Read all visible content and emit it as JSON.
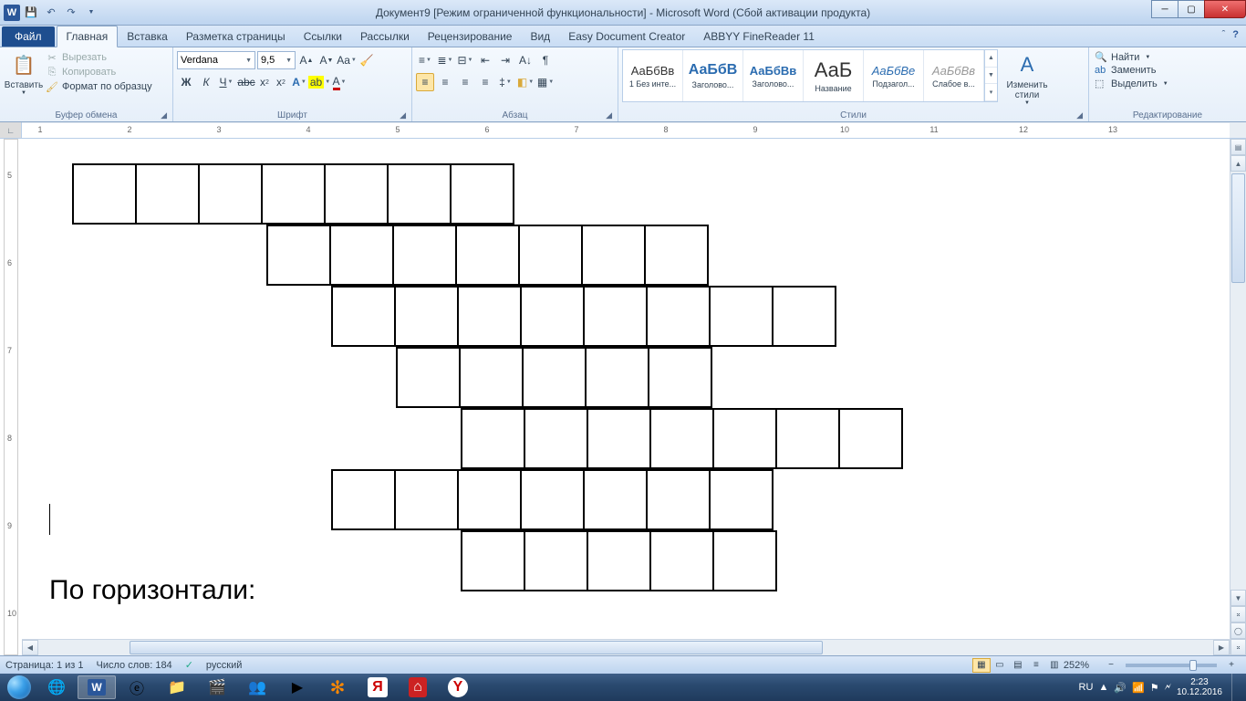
{
  "title": "Документ9 [Режим ограниченной функциональности]  -  Microsoft Word (Сбой активации продукта)",
  "tabs": {
    "file": "Файл",
    "items": [
      "Главная",
      "Вставка",
      "Разметка страницы",
      "Ссылки",
      "Рассылки",
      "Рецензирование",
      "Вид",
      "Easy Document Creator",
      "ABBYY FineReader 11"
    ],
    "active": 0
  },
  "clipboard": {
    "paste": "Вставить",
    "cut": "Вырезать",
    "copy": "Копировать",
    "fmt_painter": "Формат по образцу",
    "label": "Буфер обмена"
  },
  "font": {
    "name": "Verdana",
    "size": "9,5",
    "label": "Шрифт"
  },
  "paragraph": {
    "label": "Абзац"
  },
  "styles": {
    "label": "Стили",
    "items": [
      {
        "preview": "АаБбВв",
        "name": "1 Без инте..."
      },
      {
        "preview": "АаБбВ",
        "name": "Заголово..."
      },
      {
        "preview": "АаБбВв",
        "name": "Заголово..."
      },
      {
        "preview": "АаБ",
        "name": "Название"
      },
      {
        "preview": "АаБбВе",
        "name": "Подзагол..."
      },
      {
        "preview": "АаБбВв",
        "name": "Слабое в..."
      }
    ],
    "change": "Изменить стили"
  },
  "editing": {
    "find": "Найти",
    "replace": "Заменить",
    "select": "Выделить",
    "label": "Редактирование"
  },
  "ruler_numbers": [
    1,
    2,
    3,
    4,
    5,
    6,
    7,
    8,
    9,
    10,
    11,
    12,
    13
  ],
  "ruler_v_numbers": [
    5,
    6,
    7,
    8,
    9,
    10
  ],
  "document": {
    "heading": "По горизонтали:",
    "crossword": [
      [
        1,
        1,
        1,
        1,
        1,
        1,
        1,
        0,
        0,
        0,
        0,
        0,
        0
      ],
      [
        0,
        0,
        0,
        1,
        1,
        1,
        1,
        1,
        1,
        1,
        0,
        0,
        0
      ],
      [
        0,
        0,
        0,
        0,
        1,
        1,
        1,
        1,
        1,
        1,
        1,
        1,
        0
      ],
      [
        0,
        0,
        0,
        0,
        0,
        1,
        1,
        1,
        1,
        1,
        0,
        0,
        0
      ],
      [
        0,
        0,
        0,
        0,
        0,
        0,
        1,
        1,
        1,
        1,
        1,
        1,
        1
      ],
      [
        0,
        0,
        0,
        0,
        1,
        1,
        1,
        1,
        1,
        1,
        1,
        0,
        0
      ],
      [
        0,
        0,
        0,
        0,
        0,
        0,
        1,
        1,
        1,
        1,
        1,
        0,
        0
      ]
    ]
  },
  "status": {
    "page": "Страница: 1 из 1",
    "words": "Число слов: 184",
    "lang": "русский",
    "zoom": "252%"
  },
  "tray": {
    "lang": "RU",
    "time": "2:23",
    "date": "10.12.2016"
  }
}
